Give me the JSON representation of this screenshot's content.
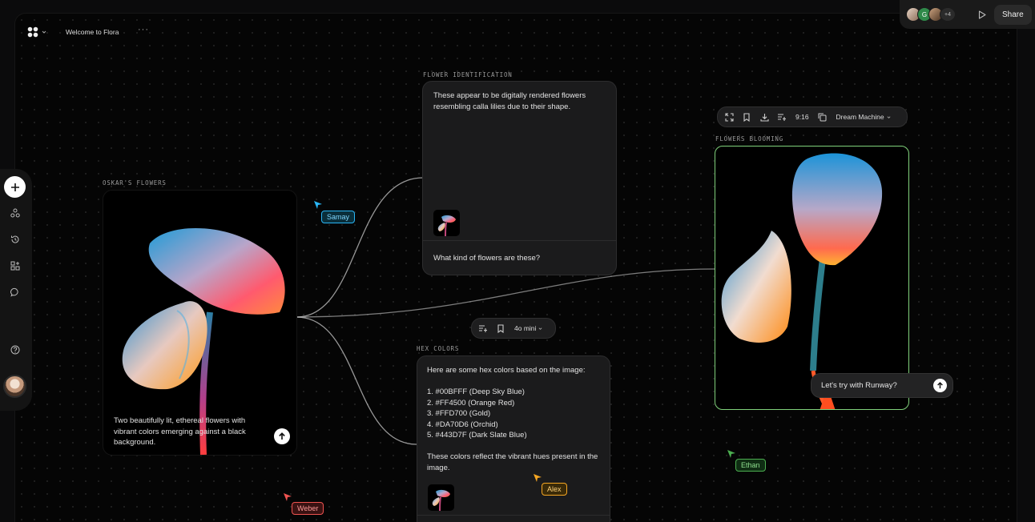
{
  "header": {
    "title": "Welcome to Flora",
    "more": "···"
  },
  "topbar": {
    "extra_count": "+4",
    "avatar_initial": "G",
    "share_label": "Share"
  },
  "nodes": {
    "oskar": {
      "label": "OSKAR'S FLOWERS",
      "caption": "Two beautifully lit, ethereal flowers with vibrant colors emerging against a black background."
    },
    "identification": {
      "label": "FLOWER IDENTIFICATION",
      "answer": "These appear to be digitally rendered flowers resembling calla lilies due to their shape.",
      "question": "What kind of flowers are these?"
    },
    "hex": {
      "label": "HEX COLORS",
      "intro": "Here are some hex colors based on the image:",
      "items": [
        "1. #00BFFF (Deep Sky Blue)",
        "2. #FF4500 (Orange Red)",
        "3. #FFD700 (Gold)",
        "4. #DA70D6 (Orchid)",
        "5. #443D7F (Dark Slate Blue)"
      ],
      "outro": "These colors reflect the vibrant hues present in the image."
    },
    "blooming": {
      "label": "FLOWERS BLOOMING",
      "prompt": "Let's try with Runway?"
    }
  },
  "mid_toolbar": {
    "model": "4o mini"
  },
  "image_toolbar": {
    "ratio": "9:16",
    "model": "Dream Machine"
  },
  "collaborators": [
    {
      "name": "Samay",
      "color": "#29b6f6"
    },
    {
      "name": "Ethan",
      "color": "#4caf50"
    },
    {
      "name": "Alex",
      "color": "#f5a623"
    },
    {
      "name": "Weber",
      "color": "#ef5350"
    }
  ],
  "colors": {
    "accent_green": "#7fd07a",
    "background": "#050505",
    "card": "#1b1b1c"
  }
}
